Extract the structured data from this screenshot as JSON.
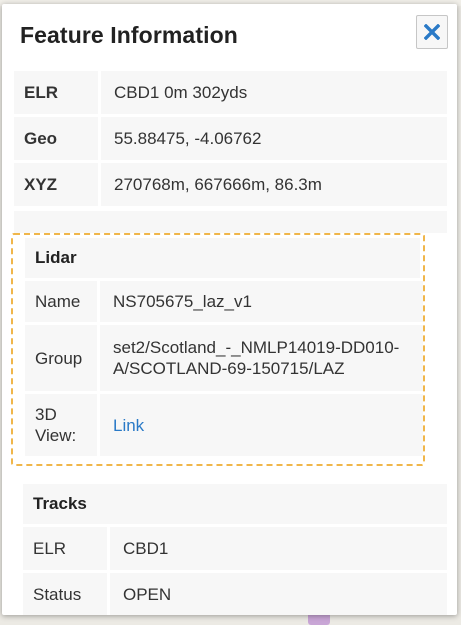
{
  "panel": {
    "title": "Feature Information",
    "close_icon": "close-x-icon",
    "accent_color": "#2a7ac7",
    "highlight_color": "#f0b64a"
  },
  "summary": [
    {
      "label": "ELR",
      "value": "CBD1 0m 302yds"
    },
    {
      "label": "Geo",
      "value": "55.88475, -4.06762"
    },
    {
      "label": "XYZ",
      "value": "270768m, 667666m, 86.3m"
    }
  ],
  "lidar": {
    "heading": "Lidar",
    "rows": [
      {
        "label": "Name",
        "value": "NS705675_laz_v1"
      },
      {
        "label": "Group",
        "value": "set2/Scotland_-_NMLP14019-DD010-A/SCOTLAND-69-150715/LAZ"
      },
      {
        "label": "3D View:",
        "value": "Link"
      }
    ]
  },
  "tracks": {
    "heading": "Tracks",
    "rows": [
      {
        "label": "ELR",
        "value": "CBD1"
      },
      {
        "label": "Status",
        "value": "OPEN"
      }
    ]
  }
}
